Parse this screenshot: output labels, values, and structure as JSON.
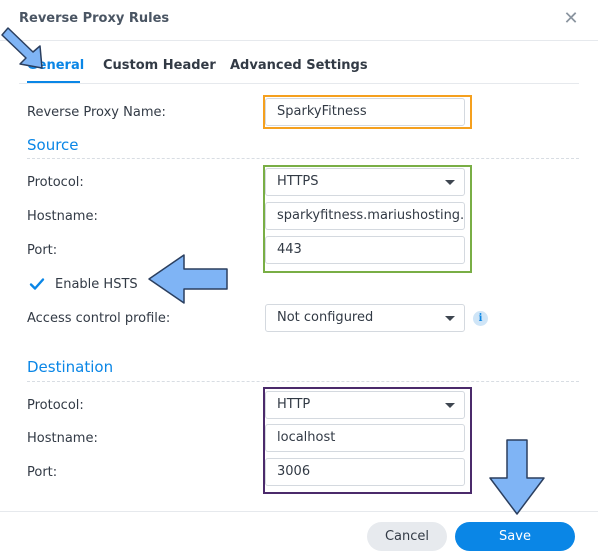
{
  "dialog": {
    "title": "Reverse Proxy Rules"
  },
  "tabs": [
    {
      "label": "General",
      "active": true
    },
    {
      "label": "Custom Header",
      "active": false
    },
    {
      "label": "Advanced Settings",
      "active": false
    }
  ],
  "general": {
    "name_label": "Reverse Proxy Name:",
    "name_value": "SparkyFitness"
  },
  "source": {
    "heading": "Source",
    "protocol_label": "Protocol:",
    "protocol_value": "HTTPS",
    "hostname_label": "Hostname:",
    "hostname_value": "sparkyfitness.mariushosting.synology.me",
    "port_label": "Port:",
    "port_value": "443",
    "hsts_label": "Enable HSTS",
    "hsts_checked": true,
    "access_label": "Access control profile:",
    "access_value": "Not configured"
  },
  "destination": {
    "heading": "Destination",
    "protocol_label": "Protocol:",
    "protocol_value": "HTTP",
    "hostname_label": "Hostname:",
    "hostname_value": "localhost",
    "port_label": "Port:",
    "port_value": "3006"
  },
  "buttons": {
    "cancel": "Cancel",
    "save": "Save"
  },
  "colors": {
    "accent": "#0a86e6",
    "highlight_name": "#f5a01e",
    "highlight_source": "#79ae45",
    "highlight_destination": "#4b2a6b",
    "arrow_fill": "#7fb4f5",
    "arrow_stroke": "#2b3f5f"
  }
}
